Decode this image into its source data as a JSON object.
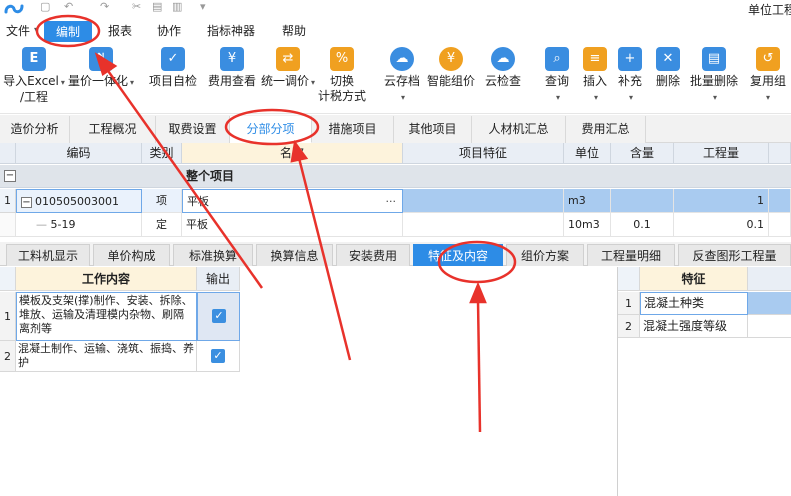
{
  "window": {
    "title": "单位工程"
  },
  "menubar": {
    "items": [
      "文件",
      "编制",
      "报表",
      "协作",
      "指标神器",
      "帮助"
    ],
    "active": "编制"
  },
  "ribbon": {
    "buttons": [
      {
        "label1": "导入Excel",
        "label2": "/工程",
        "icon": "excel-import-icon",
        "dropdown": true
      },
      {
        "label1": "量价一体化",
        "label2": "",
        "icon": "quantity-price-icon",
        "dropdown": true
      },
      {
        "label1": "项目自检",
        "label2": "",
        "icon": "self-check-icon",
        "dropdown": false
      },
      {
        "label1": "费用查看",
        "label2": "",
        "icon": "fee-view-icon",
        "dropdown": false
      },
      {
        "label1": "统一调价",
        "label2": "",
        "icon": "unify-price-icon",
        "dropdown": true
      },
      {
        "label1": "切换",
        "label2": "计税方式",
        "icon": "switch-tax-icon",
        "dropdown": false
      },
      {
        "label1": "云存档",
        "label2": "",
        "icon": "cloud-save-icon",
        "dropdown": true
      },
      {
        "label1": "智能组价",
        "label2": "",
        "icon": "smart-price-icon",
        "dropdown": false
      },
      {
        "label1": "云检查",
        "label2": "",
        "icon": "cloud-check-icon",
        "dropdown": false
      },
      {
        "label1": "查询",
        "label2": "",
        "icon": "query-icon",
        "dropdown": true
      },
      {
        "label1": "插入",
        "label2": "",
        "icon": "insert-icon",
        "dropdown": true
      },
      {
        "label1": "补充",
        "label2": "",
        "icon": "supplement-icon",
        "dropdown": true
      },
      {
        "label1": "删除",
        "label2": "",
        "icon": "delete-icon",
        "dropdown": false
      },
      {
        "label1": "批量删除",
        "label2": "",
        "icon": "batch-delete-icon",
        "dropdown": true
      },
      {
        "label1": "复用组",
        "label2": "",
        "icon": "reuse-icon",
        "dropdown": true
      }
    ]
  },
  "tabs1": {
    "items": [
      "造价分析",
      "工程概况",
      "取费设置",
      "分部分项",
      "措施项目",
      "其他项目",
      "人材机汇总",
      "费用汇总"
    ],
    "active": "分部分项"
  },
  "grid1": {
    "headers": [
      "编码",
      "类别",
      "名称",
      "项目特征",
      "单位",
      "含量",
      "工程量"
    ],
    "group_label": "整个项目",
    "rows": [
      {
        "index": "1",
        "code": "010505003001",
        "type": "项",
        "name": "平板",
        "feature": "",
        "unit": "m3",
        "content": "",
        "quantity": "1",
        "more": "···"
      },
      {
        "index": "",
        "code": "5-19",
        "type": "定",
        "name": "平板",
        "feature": "",
        "unit": "10m3",
        "content": "0.1",
        "quantity": "0.1",
        "more": ""
      }
    ]
  },
  "tabs2": {
    "items": [
      "工料机显示",
      "单价构成",
      "标准换算",
      "换算信息",
      "安装费用",
      "特征及内容",
      "组价方案",
      "工程量明细",
      "反查图形工程量"
    ],
    "active": "特征及内容"
  },
  "work_content": {
    "headers": [
      "工作内容",
      "输出"
    ],
    "rows": [
      {
        "index": "1",
        "text": "模板及支架(撑)制作、安装、拆除、堆放、运输及清理模内杂物、刷隔离剂等",
        "checked": true
      },
      {
        "index": "2",
        "text": "混凝土制作、运输、浇筑、振捣、养护",
        "checked": true
      }
    ]
  },
  "feature_panel": {
    "header": "特征",
    "rows": [
      {
        "index": "1",
        "text": "混凝土种类"
      },
      {
        "index": "2",
        "text": "混凝土强度等级"
      }
    ]
  },
  "colors": {
    "accent": "#2d8ce6",
    "annotation": "#e8322b"
  }
}
